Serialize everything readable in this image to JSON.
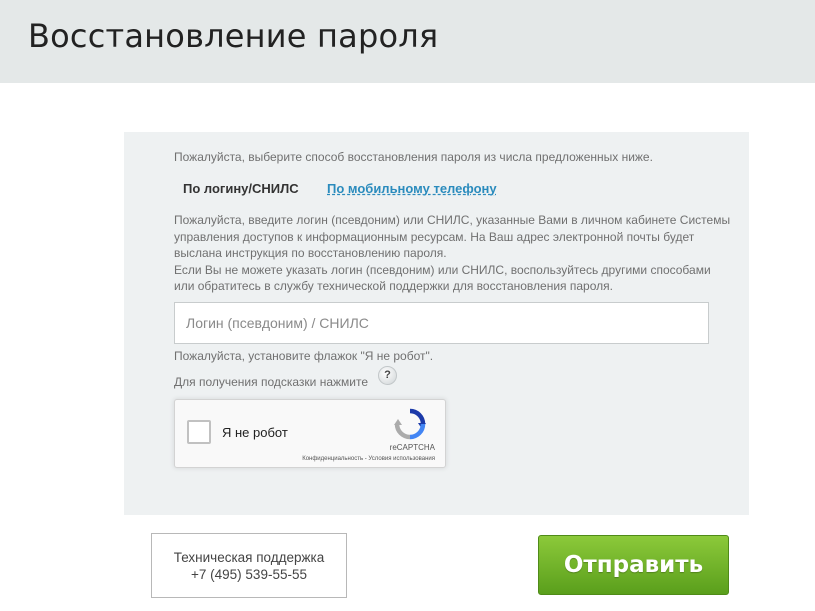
{
  "header": {
    "title": "Восстановление пароля"
  },
  "form": {
    "intro": "Пожалуйста, выберите способ восстановления пароля из числа предложенных ниже.",
    "tabs": [
      {
        "label": "По логину/СНИЛС",
        "active": true
      },
      {
        "label": "По мобильному телефону",
        "active": false
      }
    ],
    "description": [
      "Пожалуйста, введите логин (псевдоним) или СНИЛС, указанные Вами в личном кабинете Системы управления доступов к информационным ресурсам. На Ваш адрес электронной почты будет выслана инструкция по восстановлению пароля.",
      "Если Вы не можете указать логин (псевдоним) или СНИЛС, воспользуйтесь другими способами или обратитесь в службу технической поддержки для восстановления пароля."
    ],
    "login_input": {
      "placeholder": "Логин (псевдоним) / СНИЛС",
      "value": ""
    },
    "robot_note": "Пожалуйста, установите флажок \"Я не робот\".",
    "hint_text": "Для получения подсказки нажмите",
    "hint_icon": {
      "icon": "question-mark-icon",
      "label": "?"
    }
  },
  "captcha": {
    "label": "Я не робот",
    "brand": "reCAPTCHA",
    "links": "Конфиденциальность - Условия использования",
    "icon": "recaptcha-logo-icon"
  },
  "support": {
    "line1": "Техническая поддержка",
    "line2": "+7 (495) 539-55-55"
  },
  "submit": {
    "label": "Отправить"
  },
  "colors": {
    "header_bg": "#e4e8e8",
    "panel_bg": "#eef1f2",
    "link": "#2a8bbd",
    "submit_green": "#6cb32a"
  }
}
